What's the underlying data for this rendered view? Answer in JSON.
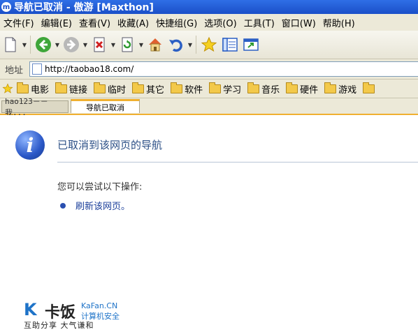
{
  "window": {
    "title": "导航已取消 - 傲游 [Maxthon]",
    "icon": "maxthon-icon"
  },
  "menu": [
    "文件(F)",
    "编辑(E)",
    "查看(V)",
    "收藏(A)",
    "快捷组(G)",
    "选项(O)",
    "工具(T)",
    "窗口(W)",
    "帮助(H)"
  ],
  "address": {
    "label": "地址",
    "url": "http://taobao18.com/"
  },
  "favorites": [
    "电影",
    "链接",
    "临时",
    "其它",
    "软件",
    "学习",
    "音乐",
    "硬件",
    "游戏"
  ],
  "tabs": [
    {
      "label": "hao123－－我...",
      "active": false
    },
    {
      "label": "导航已取消",
      "active": true
    }
  ],
  "page": {
    "heading": "已取消到该网页的导航",
    "subtext": "您可以尝试以下操作:",
    "action": "刷新该网页。"
  },
  "logo": {
    "name": "卡饭",
    "en": "KaFan.CN",
    "cn": "计算机安全",
    "slogan": "互助分享  大气谦和"
  },
  "colors": {
    "accent": "#f0b030",
    "link": "#1a3e9a",
    "title_bar": "#1a4fc8"
  }
}
